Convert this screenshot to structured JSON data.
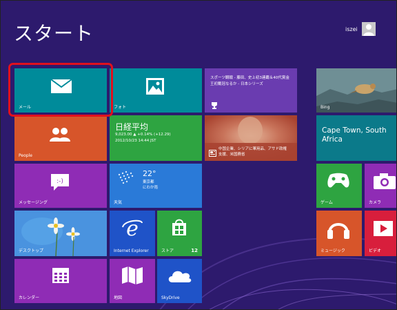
{
  "start_title": "スタート",
  "user": {
    "name": "iszei"
  },
  "tiles": {
    "mail": {
      "label": "メール"
    },
    "photos": {
      "label": "フォト"
    },
    "sports": {
      "text": "スポーツ観戦 - 藤田、史上初3連覇＆40代賞金王初戴冠なるか - 日本シリーズ"
    },
    "people": {
      "label": "People"
    },
    "finance": {
      "title": "日経平均",
      "value_line": "9,023.00 ▲ +0.14% (+12.29)",
      "date_line": "2012/10/23 14:44 JST"
    },
    "news": {
      "text": "中国企業、シリアに軍用品、アサド政権支援、米国務省"
    },
    "messaging": {
      "label": "メッセージング"
    },
    "weather": {
      "temp": "22°",
      "city": "東京都",
      "condition": "にわか雨",
      "label": "天気"
    },
    "desktop": {
      "label": "デスクトップ"
    },
    "ie": {
      "label": "Internet Explorer"
    },
    "store": {
      "label": "ストア",
      "badge": "12"
    },
    "calendar": {
      "label": "カレンダー"
    },
    "maps": {
      "label": "地図"
    },
    "skydrive": {
      "label": "SkyDrive"
    },
    "bing": {
      "label": "Bing"
    },
    "travel": {
      "city": "Cape Town, South Africa"
    },
    "games": {
      "label": "ゲーム"
    },
    "camera": {
      "label": "カメラ"
    },
    "music": {
      "label": "ミュージック"
    },
    "video": {
      "label": "ビデオ"
    }
  },
  "colors": {
    "background": "#2d1a6d",
    "teal": "#008b9a",
    "orange": "#d7552a",
    "purple": "#8f2cb5",
    "sports_purple": "#6a3cb0",
    "green": "#2ea441",
    "blue": "#2a7ad8",
    "dark_blue": "#1f53c8",
    "highlight_red": "#e0101e"
  }
}
